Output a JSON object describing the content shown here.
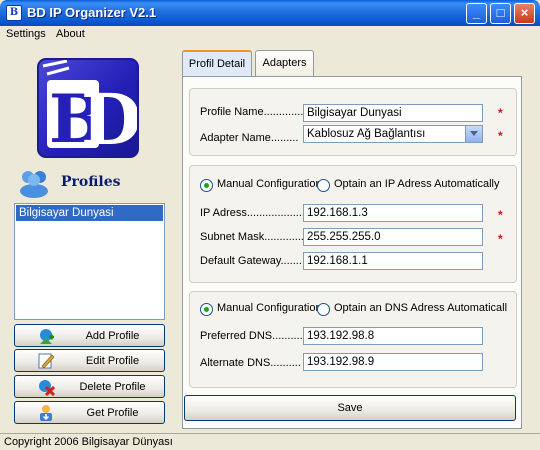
{
  "window": {
    "title": "BD IP Organizer V2.1"
  },
  "menu": {
    "settings": "Settings",
    "about": "About"
  },
  "sidebar": {
    "heading": "Profiles",
    "profiles": [
      "Bilgisayar Dunyasi"
    ],
    "buttons": {
      "add": "Add Profile",
      "edit": "Edit Profile",
      "delete": "Delete Profile",
      "get": "Get Profile"
    }
  },
  "tabs": [
    {
      "label": "Profil Detail",
      "active": true
    },
    {
      "label": "Adapters",
      "active": false
    }
  ],
  "profile": {
    "name_label": "Profile Name.............",
    "name_value": "Bilgisayar Dunyasi",
    "adapter_label": "Adapter Name.........",
    "adapter_value": "Kablosuz Ağ Bağlantısı"
  },
  "ip_config": {
    "manual_label": "Manual Configuration",
    "auto_label": "Optain an IP Adress Automatically",
    "mode": "manual",
    "ip_label": "IP Adress.....................",
    "ip_value": "192.168.1.3",
    "mask_label": "Subnet Mask................",
    "mask_value": "255.255.255.0",
    "gateway_label": "Default Gateway.......",
    "gateway_value": "192.168.1.1"
  },
  "dns_config": {
    "manual_label": "Manual Configuration",
    "auto_label": "Optain an DNS Adress Automaticall",
    "mode": "manual",
    "preferred_label": "Preferred DNS..........",
    "preferred_value": "193.192.98.8",
    "alternate_label": "Alternate DNS..........",
    "alternate_value": "193.192.98.9"
  },
  "actions": {
    "save": "Save"
  },
  "required_mark": "*",
  "status": {
    "text": "Copyright 2006 Bilgisayar Dünyası"
  },
  "icons": {
    "window_controls": [
      "minimize-icon",
      "maximize-icon",
      "close-icon"
    ],
    "add": "add-profile-icon",
    "edit": "edit-profile-icon",
    "delete": "delete-profile-icon",
    "get": "get-profile-icon"
  },
  "colors": {
    "titlebar": "#0b55cf",
    "selection": "#316ac5",
    "required": "#d01010",
    "logo": "#2420b8",
    "active_tab_accent": "#e69a20"
  }
}
